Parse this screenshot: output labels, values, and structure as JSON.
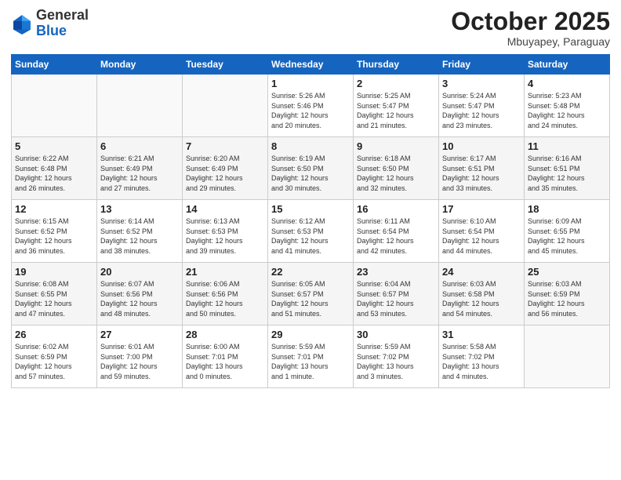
{
  "header": {
    "logo_line1": "General",
    "logo_line2": "Blue",
    "title": "October 2025",
    "location": "Mbuyapey, Paraguay"
  },
  "weekdays": [
    "Sunday",
    "Monday",
    "Tuesday",
    "Wednesday",
    "Thursday",
    "Friday",
    "Saturday"
  ],
  "weeks": [
    [
      {
        "day": "",
        "info": ""
      },
      {
        "day": "",
        "info": ""
      },
      {
        "day": "",
        "info": ""
      },
      {
        "day": "1",
        "info": "Sunrise: 5:26 AM\nSunset: 5:46 PM\nDaylight: 12 hours\nand 20 minutes."
      },
      {
        "day": "2",
        "info": "Sunrise: 5:25 AM\nSunset: 5:47 PM\nDaylight: 12 hours\nand 21 minutes."
      },
      {
        "day": "3",
        "info": "Sunrise: 5:24 AM\nSunset: 5:47 PM\nDaylight: 12 hours\nand 23 minutes."
      },
      {
        "day": "4",
        "info": "Sunrise: 5:23 AM\nSunset: 5:48 PM\nDaylight: 12 hours\nand 24 minutes."
      }
    ],
    [
      {
        "day": "5",
        "info": "Sunrise: 6:22 AM\nSunset: 6:48 PM\nDaylight: 12 hours\nand 26 minutes."
      },
      {
        "day": "6",
        "info": "Sunrise: 6:21 AM\nSunset: 6:49 PM\nDaylight: 12 hours\nand 27 minutes."
      },
      {
        "day": "7",
        "info": "Sunrise: 6:20 AM\nSunset: 6:49 PM\nDaylight: 12 hours\nand 29 minutes."
      },
      {
        "day": "8",
        "info": "Sunrise: 6:19 AM\nSunset: 6:50 PM\nDaylight: 12 hours\nand 30 minutes."
      },
      {
        "day": "9",
        "info": "Sunrise: 6:18 AM\nSunset: 6:50 PM\nDaylight: 12 hours\nand 32 minutes."
      },
      {
        "day": "10",
        "info": "Sunrise: 6:17 AM\nSunset: 6:51 PM\nDaylight: 12 hours\nand 33 minutes."
      },
      {
        "day": "11",
        "info": "Sunrise: 6:16 AM\nSunset: 6:51 PM\nDaylight: 12 hours\nand 35 minutes."
      }
    ],
    [
      {
        "day": "12",
        "info": "Sunrise: 6:15 AM\nSunset: 6:52 PM\nDaylight: 12 hours\nand 36 minutes."
      },
      {
        "day": "13",
        "info": "Sunrise: 6:14 AM\nSunset: 6:52 PM\nDaylight: 12 hours\nand 38 minutes."
      },
      {
        "day": "14",
        "info": "Sunrise: 6:13 AM\nSunset: 6:53 PM\nDaylight: 12 hours\nand 39 minutes."
      },
      {
        "day": "15",
        "info": "Sunrise: 6:12 AM\nSunset: 6:53 PM\nDaylight: 12 hours\nand 41 minutes."
      },
      {
        "day": "16",
        "info": "Sunrise: 6:11 AM\nSunset: 6:54 PM\nDaylight: 12 hours\nand 42 minutes."
      },
      {
        "day": "17",
        "info": "Sunrise: 6:10 AM\nSunset: 6:54 PM\nDaylight: 12 hours\nand 44 minutes."
      },
      {
        "day": "18",
        "info": "Sunrise: 6:09 AM\nSunset: 6:55 PM\nDaylight: 12 hours\nand 45 minutes."
      }
    ],
    [
      {
        "day": "19",
        "info": "Sunrise: 6:08 AM\nSunset: 6:55 PM\nDaylight: 12 hours\nand 47 minutes."
      },
      {
        "day": "20",
        "info": "Sunrise: 6:07 AM\nSunset: 6:56 PM\nDaylight: 12 hours\nand 48 minutes."
      },
      {
        "day": "21",
        "info": "Sunrise: 6:06 AM\nSunset: 6:56 PM\nDaylight: 12 hours\nand 50 minutes."
      },
      {
        "day": "22",
        "info": "Sunrise: 6:05 AM\nSunset: 6:57 PM\nDaylight: 12 hours\nand 51 minutes."
      },
      {
        "day": "23",
        "info": "Sunrise: 6:04 AM\nSunset: 6:57 PM\nDaylight: 12 hours\nand 53 minutes."
      },
      {
        "day": "24",
        "info": "Sunrise: 6:03 AM\nSunset: 6:58 PM\nDaylight: 12 hours\nand 54 minutes."
      },
      {
        "day": "25",
        "info": "Sunrise: 6:03 AM\nSunset: 6:59 PM\nDaylight: 12 hours\nand 56 minutes."
      }
    ],
    [
      {
        "day": "26",
        "info": "Sunrise: 6:02 AM\nSunset: 6:59 PM\nDaylight: 12 hours\nand 57 minutes."
      },
      {
        "day": "27",
        "info": "Sunrise: 6:01 AM\nSunset: 7:00 PM\nDaylight: 12 hours\nand 59 minutes."
      },
      {
        "day": "28",
        "info": "Sunrise: 6:00 AM\nSunset: 7:01 PM\nDaylight: 13 hours\nand 0 minutes."
      },
      {
        "day": "29",
        "info": "Sunrise: 5:59 AM\nSunset: 7:01 PM\nDaylight: 13 hours\nand 1 minute."
      },
      {
        "day": "30",
        "info": "Sunrise: 5:59 AM\nSunset: 7:02 PM\nDaylight: 13 hours\nand 3 minutes."
      },
      {
        "day": "31",
        "info": "Sunrise: 5:58 AM\nSunset: 7:02 PM\nDaylight: 13 hours\nand 4 minutes."
      },
      {
        "day": "",
        "info": ""
      }
    ]
  ]
}
